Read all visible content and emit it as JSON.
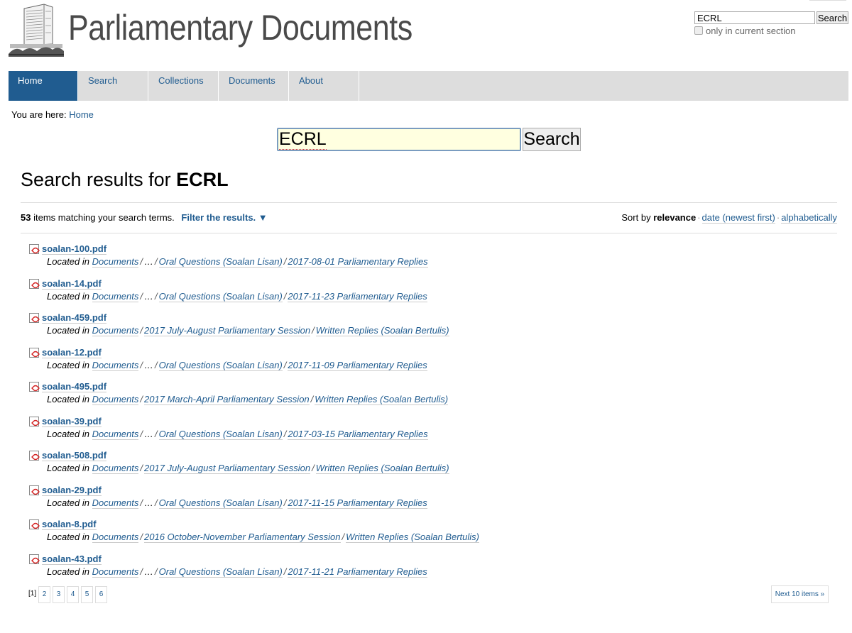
{
  "site": {
    "title": "Parliamentary Documents",
    "logo": "parliament-building-logo"
  },
  "top_search": {
    "value": "ECRL",
    "button_label": "Search",
    "checkbox_label": "only in current section",
    "checkbox_checked": false
  },
  "nav": {
    "items": [
      {
        "label": "Home",
        "active": true
      },
      {
        "label": "Search",
        "active": false
      },
      {
        "label": "Collections",
        "active": false
      },
      {
        "label": "Documents",
        "active": false
      },
      {
        "label": "About",
        "active": false
      }
    ]
  },
  "breadcrumb": {
    "prefix": "You are here:",
    "items": [
      "Home"
    ]
  },
  "main_search": {
    "value": "ECRL",
    "button_label": "Search"
  },
  "results_header": {
    "prefix": "Search results for",
    "term": "ECRL",
    "count": "53",
    "count_suffix": "items matching your search terms.",
    "filter_label": "Filter the results.",
    "filter_icon": "triangle-down",
    "sort_prefix": "Sort by",
    "sort_options": [
      {
        "label": "relevance",
        "active": true
      },
      {
        "label": "date (newest first)",
        "active": false
      },
      {
        "label": "alphabetically",
        "active": false
      }
    ]
  },
  "results": [
    {
      "title": "soalan-100.pdf",
      "icon": "pdf-icon",
      "located_label": "Located in",
      "path": [
        "Documents",
        "…",
        "Oral Questions (Soalan Lisan)",
        "2017-08-01 Parliamentary Replies"
      ]
    },
    {
      "title": "soalan-14.pdf",
      "icon": "pdf-icon",
      "located_label": "Located in",
      "path": [
        "Documents",
        "…",
        "Oral Questions (Soalan Lisan)",
        "2017-11-23 Parliamentary Replies"
      ]
    },
    {
      "title": "soalan-459.pdf",
      "icon": "pdf-icon",
      "located_label": "Located in",
      "path": [
        "Documents",
        "2017 July-August Parliamentary Session",
        "Written Replies (Soalan Bertulis)"
      ]
    },
    {
      "title": "soalan-12.pdf",
      "icon": "pdf-icon",
      "located_label": "Located in",
      "path": [
        "Documents",
        "…",
        "Oral Questions (Soalan Lisan)",
        "2017-11-09 Parliamentary Replies"
      ]
    },
    {
      "title": "soalan-495.pdf",
      "icon": "pdf-icon",
      "located_label": "Located in",
      "path": [
        "Documents",
        "2017 March-April Parliamentary Session",
        "Written Replies (Soalan Bertulis)"
      ]
    },
    {
      "title": "soalan-39.pdf",
      "icon": "pdf-icon",
      "located_label": "Located in",
      "path": [
        "Documents",
        "…",
        "Oral Questions (Soalan Lisan)",
        "2017-03-15 Parliamentary Replies"
      ]
    },
    {
      "title": "soalan-508.pdf",
      "icon": "pdf-icon",
      "located_label": "Located in",
      "path": [
        "Documents",
        "2017 July-August Parliamentary Session",
        "Written Replies (Soalan Bertulis)"
      ]
    },
    {
      "title": "soalan-29.pdf",
      "icon": "pdf-icon",
      "located_label": "Located in",
      "path": [
        "Documents",
        "…",
        "Oral Questions (Soalan Lisan)",
        "2017-11-15 Parliamentary Replies"
      ]
    },
    {
      "title": "soalan-8.pdf",
      "icon": "pdf-icon",
      "located_label": "Located in",
      "path": [
        "Documents",
        "2016 October-November Parliamentary Session",
        "Written Replies (Soalan Bertulis)"
      ]
    },
    {
      "title": "soalan-43.pdf",
      "icon": "pdf-icon",
      "located_label": "Located in",
      "path": [
        "Documents",
        "…",
        "Oral Questions (Soalan Lisan)",
        "2017-11-21 Parliamentary Replies"
      ]
    }
  ],
  "pagination": {
    "current": "[1]",
    "pages": [
      "2",
      "3",
      "4",
      "5",
      "6"
    ],
    "next_label": "Next 10 items »"
  },
  "colors": {
    "link": "#205c90",
    "nav_bg": "#dddddd",
    "nav_active": "#205c90",
    "search_bg": "#ffffe0"
  }
}
